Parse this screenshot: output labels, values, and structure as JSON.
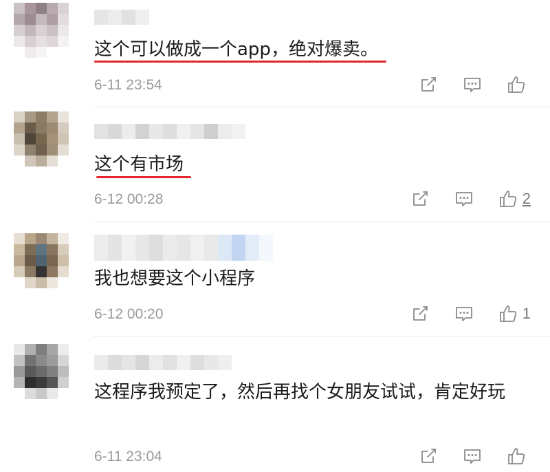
{
  "comments": [
    {
      "text": "这个可以做成一个app，绝对爆卖。",
      "time": "6-11 23:54",
      "like_count": "",
      "underlined": true
    },
    {
      "text": "这个有市场",
      "time": "6-12 00:28",
      "like_count": "2",
      "underlined": true
    },
    {
      "text": "我也想要这个小程序",
      "time": "6-12 00:20",
      "like_count": "1",
      "underlined": false
    },
    {
      "text": "这程序我预定了，然后再找个女朋友试试，肯定好玩",
      "time": "6-11 23:04",
      "like_count": "",
      "underlined": false
    }
  ],
  "icons": {
    "share": "share-icon",
    "reply": "comment-icon",
    "like": "thumbs-up-icon"
  },
  "colors": {
    "underline": "#e4252b",
    "timestamp": "#9a9a9a",
    "icon": "#8a8a8a"
  }
}
